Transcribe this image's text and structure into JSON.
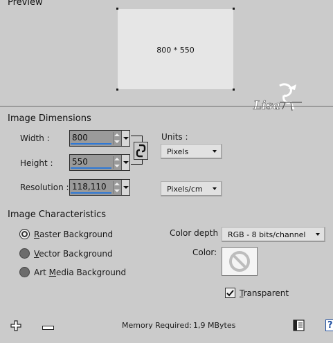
{
  "preview": {
    "title": "Preview",
    "size_text": "800 * 550",
    "watermark": "Lisa"
  },
  "dimensions": {
    "title": "Image Dimensions",
    "width_label": "Width :",
    "width_value": "800",
    "height_label": "Height :",
    "height_value": "550",
    "resolution_label": "Resolution :",
    "resolution_value": "118,110",
    "units_label": "Units :",
    "units_value": "Pixels",
    "resolution_units_value": "Pixels/cm"
  },
  "characteristics": {
    "title": "Image Characteristics",
    "raster": {
      "prefix": "",
      "mnemonic": "R",
      "rest": "aster Background"
    },
    "vector": {
      "prefix": "",
      "mnemonic": "V",
      "rest": "ector Background"
    },
    "art": {
      "prefix": "Art ",
      "mnemonic": "M",
      "rest": "edia Background"
    },
    "selected": "raster",
    "color_depth_label": "Color depth :",
    "color_depth_value": "RGB - 8 bits/channel",
    "color_label": "Color:",
    "transparent": {
      "mnemonic": "T",
      "rest": "ransparent",
      "checked": true
    }
  },
  "footer": {
    "memory_label": "Memory Required:",
    "memory_value": "1,9 MBytes",
    "help_label": "?"
  },
  "colors": {
    "background": "#cbcbcb",
    "accent": "#2e78d6"
  }
}
